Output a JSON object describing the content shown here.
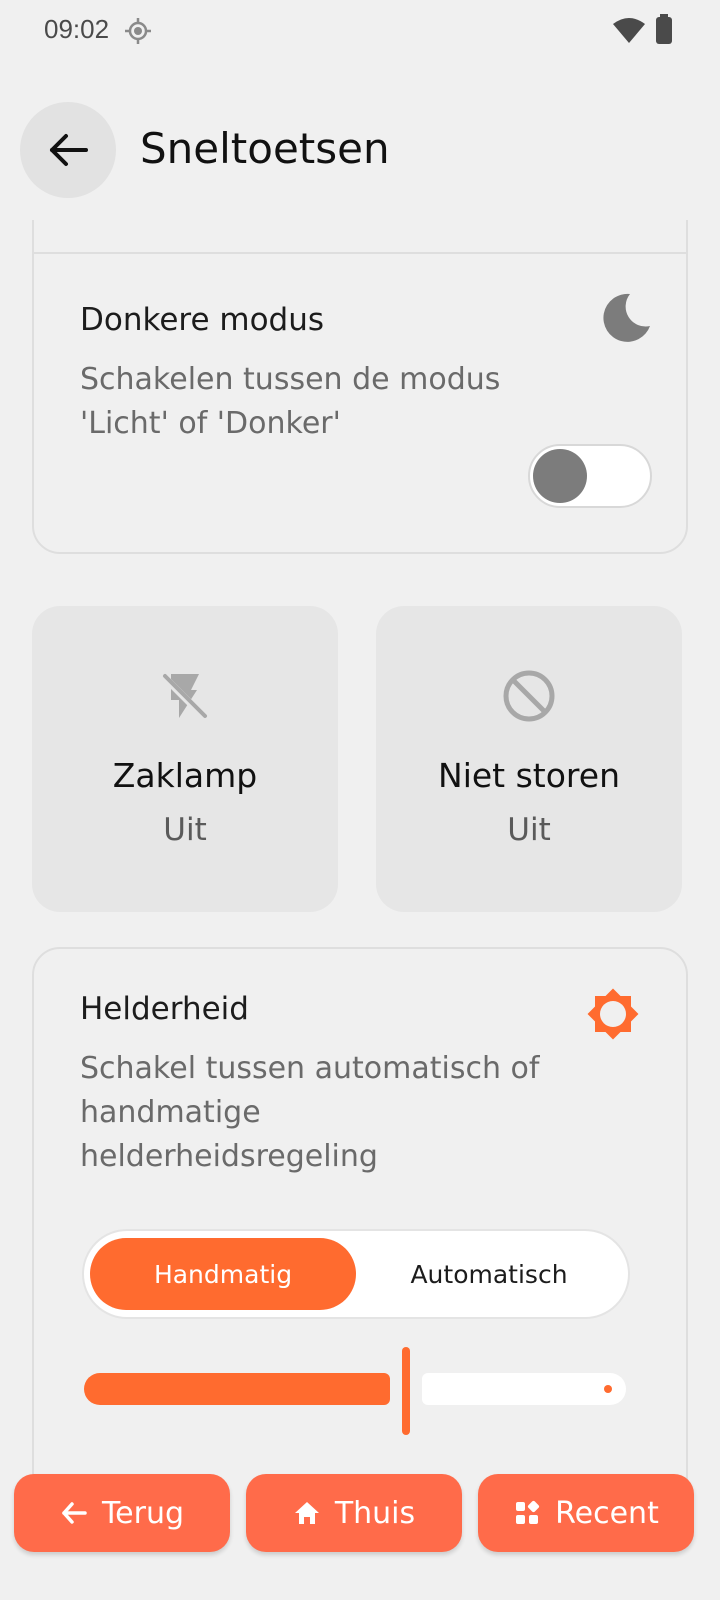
{
  "status_bar": {
    "time": "09:02"
  },
  "app_bar": {
    "title": "Sneltoetsen"
  },
  "dark_mode_card": {
    "title": "Donkere modus",
    "description": "Schakelen tussen de modus 'Licht' of 'Donker'",
    "toggle_on": false,
    "icon": "moon-icon"
  },
  "tiles": [
    {
      "label": "Zaklamp",
      "state": "Uit",
      "icon": "flashlight-off-icon"
    },
    {
      "label": "Niet storen",
      "state": "Uit",
      "icon": "do-not-disturb-icon"
    }
  ],
  "brightness_card": {
    "title": "Helderheid",
    "description": "Schakel tussen automatisch of handmatige helderheidsregeling",
    "icon": "sun-icon",
    "segments": [
      "Handmatig",
      "Automatisch"
    ],
    "selected_segment": "Handmatig",
    "slider_value": 0.58
  },
  "bottom_nav": {
    "back": "Terug",
    "home": "Thuis",
    "recent": "Recent"
  },
  "colors": {
    "accent": "#ff6b2f",
    "nav_button": "#ff6b4a",
    "background": "#f0f0f0"
  }
}
